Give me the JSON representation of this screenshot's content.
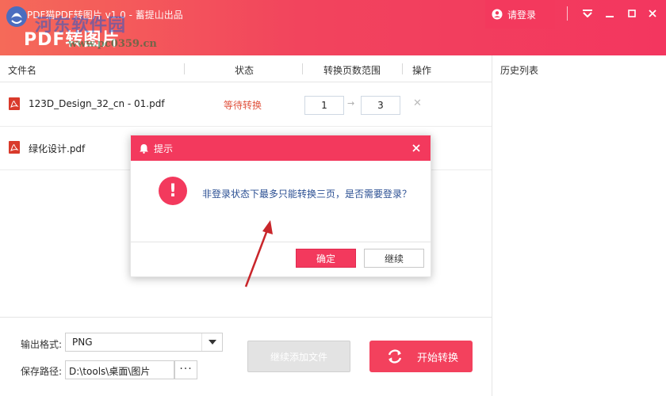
{
  "app": {
    "title": "PDF猫PDF转图片 v1.0 - 蓄提山出品",
    "big_title": "PDF转图片",
    "watermark": "河东软件园",
    "watermark_url": "www.pc0359.cn",
    "login_label": "请登录",
    "accent": "#f3395d"
  },
  "table": {
    "columns": [
      "文件名",
      "状态",
      "转换页数范围",
      "操作"
    ],
    "rows": [
      {
        "name": "123D_Design_32_cn - 01.pdf",
        "status": "等待转换",
        "from": "1",
        "to": "3"
      },
      {
        "name": "绿化设计.pdf",
        "status": "",
        "from": "",
        "to": ""
      }
    ]
  },
  "history": {
    "title": "历史列表"
  },
  "output": {
    "format_label": "输出格式:",
    "format_value": "PNG",
    "path_label": "保存路径:",
    "path_value": "D:\\tools\\桌面\\图片",
    "browse_label": "···"
  },
  "actions": {
    "add_files": "继续添加文件",
    "start": "开始转换"
  },
  "dialog": {
    "title": "提示",
    "message": "非登录状态下最多只能转换三页，是否需要登录？",
    "ok": "确定",
    "continue": "继续"
  }
}
